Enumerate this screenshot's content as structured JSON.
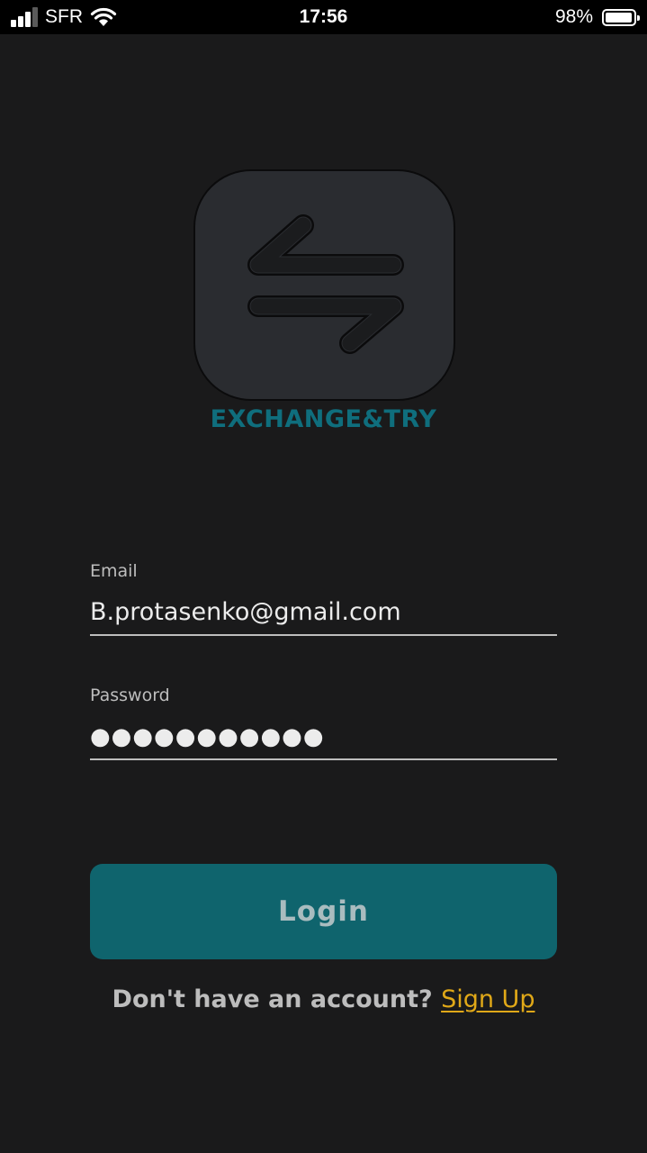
{
  "status_bar": {
    "carrier": "SFR",
    "time": "17:56",
    "battery_percent": "98%",
    "battery_level": 0.98,
    "signal_bars": 4,
    "signal_bars_active": 3,
    "icons": [
      "signal-icon",
      "wifi-icon",
      "battery-icon"
    ]
  },
  "brand": {
    "name": "EXCHANGE&TRY",
    "logo_icon": "exchange-arrows-icon",
    "accent_color": "#0f6e7d"
  },
  "form": {
    "email": {
      "label": "Email",
      "value": "B.protasenko@gmail.com"
    },
    "password": {
      "label": "Password",
      "value_masked": "●●●●●●●●●●●"
    },
    "login_button": {
      "label": "Login",
      "color": "#0f646d"
    }
  },
  "signup": {
    "prompt": "Don't have an account?",
    "link_label": "Sign Up",
    "link_color": "#e0a818"
  },
  "colors": {
    "background": "#1a1a1b",
    "status_bar": "#000000"
  }
}
